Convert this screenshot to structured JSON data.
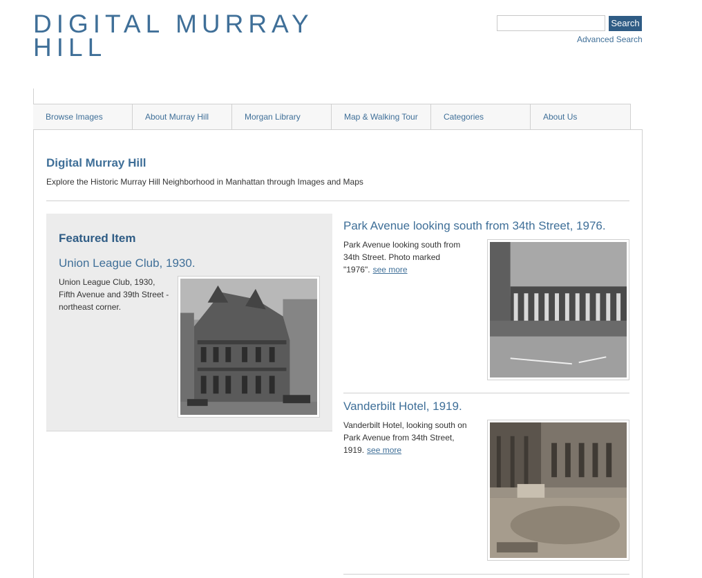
{
  "site": {
    "title": "DIGITAL MURRAY HILL"
  },
  "search": {
    "placeholder": "",
    "button_label": "Search",
    "advanced_label": "Advanced Search"
  },
  "nav": {
    "items": [
      {
        "label": "Browse Images"
      },
      {
        "label": "About Murray Hill"
      },
      {
        "label": "Morgan Library"
      },
      {
        "label": "Map & Walking Tour"
      },
      {
        "label": "Categories"
      },
      {
        "label": "About Us"
      }
    ]
  },
  "intro": {
    "title": "Digital Murray Hill",
    "description": "Explore the Historic Murray Hill Neighborhood in Manhattan through Images and Maps"
  },
  "featured": {
    "heading": "Featured Item",
    "title": "Union League Club, 1930.",
    "description": "Union League Club, 1930, Fifth Avenue and 39th Street - northeast corner."
  },
  "items": [
    {
      "title": "Park Avenue looking south from 34th Street, 1976.",
      "description": "Park Avenue looking south from 34th Street. Photo marked \"1976\".",
      "link_label": "see more"
    },
    {
      "title": "Vanderbilt Hotel, 1919.",
      "description": "Vanderbilt Hotel, looking south on Park Avenue from 34th Street, 1919.",
      "link_label": "see more"
    }
  ]
}
